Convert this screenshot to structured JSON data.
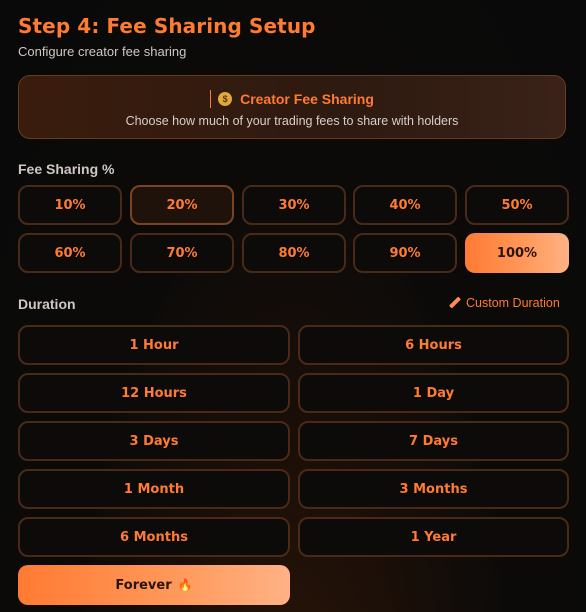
{
  "header": {
    "title": "Step 4: Fee Sharing Setup",
    "subtitle": "Configure creator fee sharing"
  },
  "info": {
    "icon": "money-bag-icon",
    "heading": "Creator Fee Sharing",
    "description": "Choose how much of your trading fees to share with holders"
  },
  "fee_sharing": {
    "label": "Fee Sharing %",
    "options": [
      "10%",
      "20%",
      "30%",
      "40%",
      "50%",
      "60%",
      "70%",
      "80%",
      "90%",
      "100%"
    ],
    "selected": "100%",
    "hovered": "20%"
  },
  "duration": {
    "label": "Duration",
    "custom_label": "Custom Duration",
    "custom_icon": "pencil-icon",
    "options": [
      "1 Hour",
      "6 Hours",
      "12 Hours",
      "1 Day",
      "3 Days",
      "7 Days",
      "1 Month",
      "3 Months",
      "6 Months",
      "1 Year",
      "Forever"
    ],
    "selected": "Forever",
    "selected_icon": "fire-icon"
  },
  "colors": {
    "accent": "#ff7a33",
    "accent_light": "#ffb286",
    "border": "#4a2a17",
    "background": "#0a0909"
  }
}
